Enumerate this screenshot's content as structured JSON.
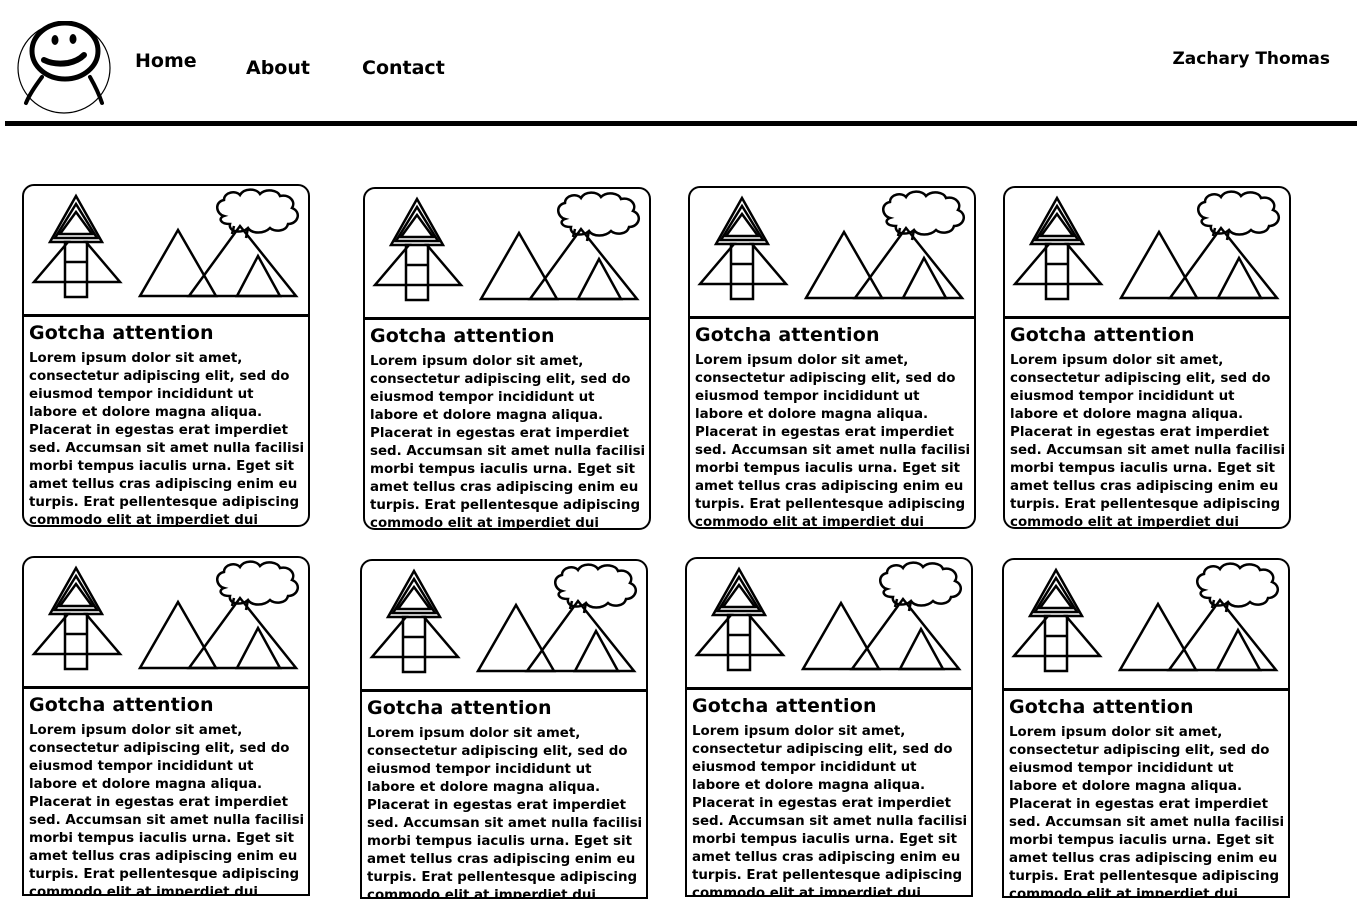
{
  "nav": {
    "logo_icon": "smiley-face-logo-icon",
    "home_label": "Home",
    "about_label": "About",
    "contact_label": "Contact",
    "user_name": "Zachary Thomas"
  },
  "cards": [
    {
      "image_icon": "tree-mountains-cloud-image",
      "title": "Gotcha attention",
      "text": "Lorem ipsum dolor sit amet, consectetur adipiscing elit, sed do eiusmod tempor incididunt ut labore et dolore magna aliqua. Placerat in egestas erat imperdiet sed. Accumsan sit amet nulla facilisi morbi tempus iaculis urna. Eget sit amet tellus cras adipiscing enim eu turpis. Erat pellentesque adipiscing commodo elit at imperdiet dui accumsan sit."
    },
    {
      "image_icon": "tree-mountains-cloud-image",
      "title": "Gotcha attention",
      "text": "Lorem ipsum dolor sit amet, consectetur adipiscing elit, sed do eiusmod tempor incididunt ut labore et dolore magna aliqua. Placerat in egestas erat imperdiet sed. Accumsan sit amet nulla facilisi morbi tempus iaculis urna. Eget sit amet tellus cras adipiscing enim eu turpis. Erat pellentesque adipiscing commodo elit at imperdiet dui accumsan sit."
    },
    {
      "image_icon": "tree-mountains-cloud-image",
      "title": "Gotcha attention",
      "text": "Lorem ipsum dolor sit amet, consectetur adipiscing elit, sed do eiusmod tempor incididunt ut labore et dolore magna aliqua. Placerat in egestas erat imperdiet sed. Accumsan sit amet nulla facilisi morbi tempus iaculis urna. Eget sit amet tellus cras adipiscing enim eu turpis. Erat pellentesque adipiscing commodo elit at imperdiet dui accumsan sit."
    },
    {
      "image_icon": "tree-mountains-cloud-image",
      "title": "Gotcha attention",
      "text": "Lorem ipsum dolor sit amet, consectetur adipiscing elit, sed do eiusmod tempor incididunt ut labore et dolore magna aliqua. Placerat in egestas erat imperdiet sed. Accumsan sit amet nulla facilisi morbi tempus iaculis urna. Eget sit amet tellus cras adipiscing enim eu turpis. Erat pellentesque adipiscing commodo elit at imperdiet dui accumsan sit."
    },
    {
      "image_icon": "tree-mountains-cloud-image",
      "title": "Gotcha attention",
      "text": "Lorem ipsum dolor sit amet, consectetur adipiscing elit, sed do eiusmod tempor incididunt ut labore et dolore magna aliqua. Placerat in egestas erat imperdiet sed. Accumsan sit amet nulla facilisi morbi tempus iaculis urna. Eget sit amet tellus cras adipiscing enim eu turpis. Erat pellentesque adipiscing commodo elit at imperdiet dui accumsan"
    },
    {
      "image_icon": "tree-mountains-cloud-image",
      "title": "Gotcha attention",
      "text": "Lorem ipsum dolor sit amet, consectetur adipiscing elit, sed do eiusmod tempor incididunt ut labore et dolore magna aliqua. Placerat in egestas erat imperdiet sed. Accumsan sit amet nulla facilisi morbi tempus iaculis urna. Eget sit amet tellus cras adipiscing enim eu turpis. Erat pellentesque adipiscing commodo elit at imperdiet dui accumsan"
    },
    {
      "image_icon": "tree-mountains-cloud-image",
      "title": "Gotcha attention",
      "text": "Lorem ipsum dolor sit amet, consectetur adipiscing elit, sed do eiusmod tempor incididunt ut labore et dolore magna aliqua. Placerat in egestas erat imperdiet sed. Accumsan sit amet nulla facilisi morbi tempus iaculis urna. Eget sit amet tellus cras adipiscing enim eu turpis. Erat pellentesque adipiscing commodo elit at imperdiet dui accumsan"
    },
    {
      "image_icon": "tree-mountains-cloud-image",
      "title": "Gotcha attention",
      "text": "Lorem ipsum dolor sit amet, consectetur adipiscing elit, sed do eiusmod tempor incididunt ut labore et dolore magna aliqua. Placerat in egestas erat imperdiet sed. Accumsan sit amet nulla facilisi morbi tempus iaculis urna. Eget sit amet tellus cras adipiscing enim eu turpis. Erat pellentesque adipiscing commodo elit at imperdiet dui accumsan"
    }
  ]
}
